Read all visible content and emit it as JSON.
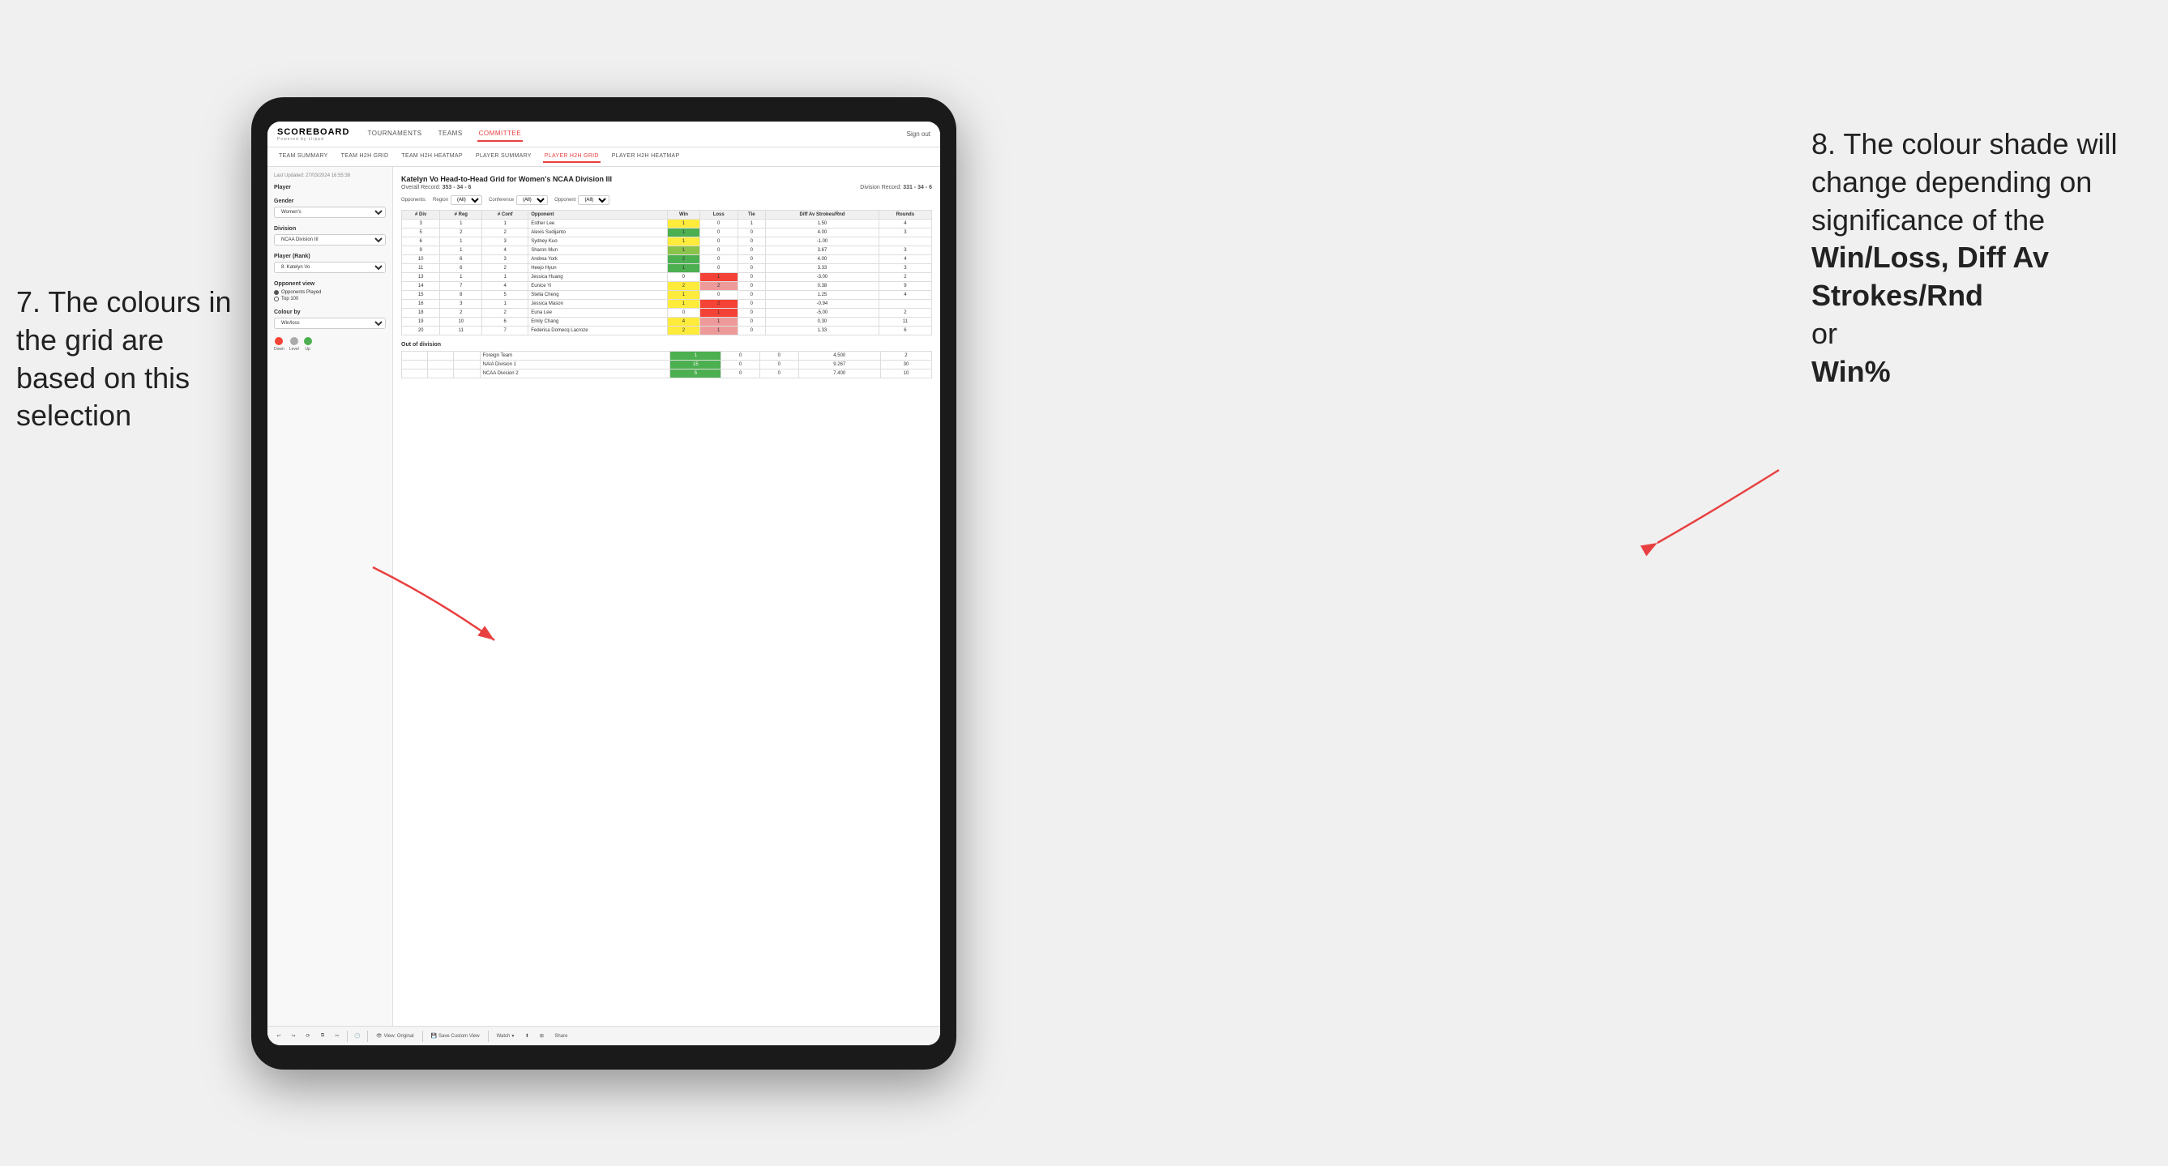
{
  "annotations": {
    "left_title": "7. The colours in the grid are based on this selection",
    "right_title": "8. The colour shade will change depending on significance of the",
    "right_bold1": "Win/Loss,",
    "right_bold2": "Diff Av Strokes/Rnd",
    "right_conjunction": "or",
    "right_bold3": "Win%"
  },
  "header": {
    "logo": "SCOREBOARD",
    "logo_sub": "Powered by clippd",
    "nav": [
      "TOURNAMENTS",
      "TEAMS",
      "COMMITTEE"
    ],
    "active_nav": "COMMITTEE",
    "sign_out": "Sign out"
  },
  "sub_nav": {
    "items": [
      "TEAM SUMMARY",
      "TEAM H2H GRID",
      "TEAM H2H HEATMAP",
      "PLAYER SUMMARY",
      "PLAYER H2H GRID",
      "PLAYER H2H HEATMAP"
    ],
    "active": "PLAYER H2H GRID"
  },
  "left_panel": {
    "last_updated": "Last Updated: 27/03/2024 16:55:38",
    "player_label": "Player",
    "gender_label": "Gender",
    "gender_value": "Women's",
    "division_label": "Division",
    "division_value": "NCAA Division III",
    "player_rank_label": "Player (Rank)",
    "player_rank_value": "8. Katelyn Vo",
    "opponent_view_label": "Opponent view",
    "opponent_view_options": [
      "Opponents Played",
      "Top 100"
    ],
    "opponent_view_selected": "Opponents Played",
    "colour_by_label": "Colour by",
    "colour_by_value": "Win/loss",
    "legend": [
      {
        "label": "Down",
        "color": "#f44336"
      },
      {
        "label": "Level",
        "color": "#aaaaaa"
      },
      {
        "label": "Up",
        "color": "#4caf50"
      }
    ]
  },
  "grid": {
    "title": "Katelyn Vo Head-to-Head Grid for Women's NCAA Division III",
    "overall_record_label": "Overall Record:",
    "overall_record_value": "353 - 34 - 6",
    "division_record_label": "Division Record:",
    "division_record_value": "331 - 34 - 6",
    "filters": {
      "opponents_label": "Opponents:",
      "region_label": "Region",
      "conference_label": "Conference",
      "opponent_label": "Opponent",
      "region_value": "(All)",
      "conference_value": "(All)",
      "opponent_value": "(All)"
    },
    "table_headers": [
      "#Div",
      "#Reg",
      "#Conf",
      "Opponent",
      "Win",
      "Loss",
      "Tie",
      "Diff Av Strokes/Rnd",
      "Rounds"
    ],
    "rows": [
      {
        "div": "3",
        "reg": "1",
        "conf": "1",
        "opponent": "Esther Lee",
        "win": 1,
        "loss": 0,
        "tie": 1,
        "diff": "1.50",
        "rounds": 4,
        "win_color": "win-yellow",
        "loss_color": "no-data"
      },
      {
        "div": "5",
        "reg": "2",
        "conf": "2",
        "opponent": "Alexis Sudijanto",
        "win": 1,
        "loss": 0,
        "tie": 0,
        "diff": "4.00",
        "rounds": 3,
        "win_color": "win-green-dark",
        "loss_color": "no-data"
      },
      {
        "div": "6",
        "reg": "1",
        "conf": "3",
        "opponent": "Sydney Kuo",
        "win": 1,
        "loss": 0,
        "tie": 0,
        "diff": "-1.00",
        "rounds": "",
        "win_color": "win-yellow",
        "loss_color": "no-data"
      },
      {
        "div": "9",
        "reg": "1",
        "conf": "4",
        "opponent": "Sharon Mun",
        "win": 1,
        "loss": 0,
        "tie": 0,
        "diff": "3.67",
        "rounds": 3,
        "win_color": "win-green-med",
        "loss_color": "no-data"
      },
      {
        "div": "10",
        "reg": "6",
        "conf": "3",
        "opponent": "Andrea York",
        "win": 2,
        "loss": 0,
        "tie": 0,
        "diff": "4.00",
        "rounds": 4,
        "win_color": "win-green-dark",
        "loss_color": "no-data"
      },
      {
        "div": "11",
        "reg": "6",
        "conf": "2",
        "opponent": "Heejo Hyun",
        "win": 1,
        "loss": 0,
        "tie": 0,
        "diff": "3.33",
        "rounds": 3,
        "win_color": "win-green-dark",
        "loss_color": "no-data"
      },
      {
        "div": "13",
        "reg": "1",
        "conf": "1",
        "opponent": "Jessica Huang",
        "win": 0,
        "loss": 1,
        "tie": 0,
        "diff": "-3.00",
        "rounds": 2,
        "win_color": "no-data",
        "loss_color": "loss-red"
      },
      {
        "div": "14",
        "reg": "7",
        "conf": "4",
        "opponent": "Eunice Yi",
        "win": 2,
        "loss": 2,
        "tie": 0,
        "diff": "0.38",
        "rounds": 9,
        "win_color": "win-yellow",
        "loss_color": "loss-red-light"
      },
      {
        "div": "15",
        "reg": "8",
        "conf": "5",
        "opponent": "Stella Cheng",
        "win": 1,
        "loss": 0,
        "tie": 0,
        "diff": "1.25",
        "rounds": 4,
        "win_color": "win-yellow",
        "loss_color": "no-data"
      },
      {
        "div": "16",
        "reg": "3",
        "conf": "1",
        "opponent": "Jessica Mason",
        "win": 1,
        "loss": 2,
        "tie": 0,
        "diff": "-0.94",
        "rounds": "",
        "win_color": "win-yellow",
        "loss_color": "loss-red"
      },
      {
        "div": "18",
        "reg": "2",
        "conf": "2",
        "opponent": "Euna Lee",
        "win": 0,
        "loss": 1,
        "tie": 0,
        "diff": "-5.00",
        "rounds": 2,
        "win_color": "no-data",
        "loss_color": "loss-red"
      },
      {
        "div": "19",
        "reg": "10",
        "conf": "6",
        "opponent": "Emily Chang",
        "win": 4,
        "loss": 1,
        "tie": 0,
        "diff": "0.30",
        "rounds": 11,
        "win_color": "win-yellow",
        "loss_color": "loss-red-light"
      },
      {
        "div": "20",
        "reg": "11",
        "conf": "7",
        "opponent": "Federica Domecq Lacroze",
        "win": 2,
        "loss": 1,
        "tie": 0,
        "diff": "1.33",
        "rounds": 6,
        "win_color": "win-yellow",
        "loss_color": "loss-red-light"
      }
    ],
    "out_division_label": "Out of division",
    "out_division_rows": [
      {
        "opponent": "Foreign Team",
        "win": 1,
        "loss": 0,
        "tie": 0,
        "diff": "4.500",
        "rounds": 2,
        "win_color": "win-green-dark"
      },
      {
        "opponent": "NAIA Division 1",
        "win": 15,
        "loss": 0,
        "tie": 0,
        "diff": "9.267",
        "rounds": 30,
        "win_color": "win-green-dark"
      },
      {
        "opponent": "NCAA Division 2",
        "win": 5,
        "loss": 0,
        "tie": 0,
        "diff": "7.400",
        "rounds": 10,
        "win_color": "win-green-dark"
      }
    ]
  },
  "toolbar": {
    "view_original": "View: Original",
    "save_custom": "Save Custom View",
    "watch": "Watch",
    "share": "Share"
  }
}
